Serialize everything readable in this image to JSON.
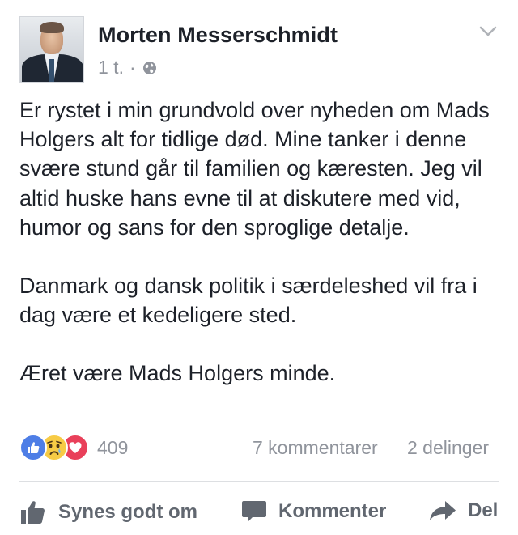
{
  "post": {
    "author": "Morten Messerschmidt",
    "time": "1 t.",
    "separator": "·",
    "privacy_icon": "globe-icon",
    "menu_icon": "chevron-down-icon",
    "paragraphs": [
      "Er rystet i min grundvold over nyheden om Mads Holgers alt for tidlige død. Mine tanker i denne svære stund går til familien og kæresten. Jeg vil altid huske hans evne til at diskutere med vid, humor og sans for den sproglige detalje.",
      "Danmark og dansk politik i særdeleshed vil fra i dag være et kedeligere sted.",
      "Æret være Mads Holgers minde."
    ]
  },
  "reactions": {
    "icons": [
      "like-reaction-icon",
      "sad-reaction-icon",
      "love-reaction-icon"
    ],
    "count": "409",
    "comments": "7 kommentarer",
    "shares": "2 delinger"
  },
  "actions": {
    "like_label": "Synes godt om",
    "comment_label": "Kommenter",
    "share_label": "Del"
  },
  "colors": {
    "text": "#1d2129",
    "meta": "#90949c",
    "action": "#616770",
    "like_blue": "#4e7ee6",
    "sad_yellow": "#f7cb45",
    "love_red": "#e9405a"
  }
}
